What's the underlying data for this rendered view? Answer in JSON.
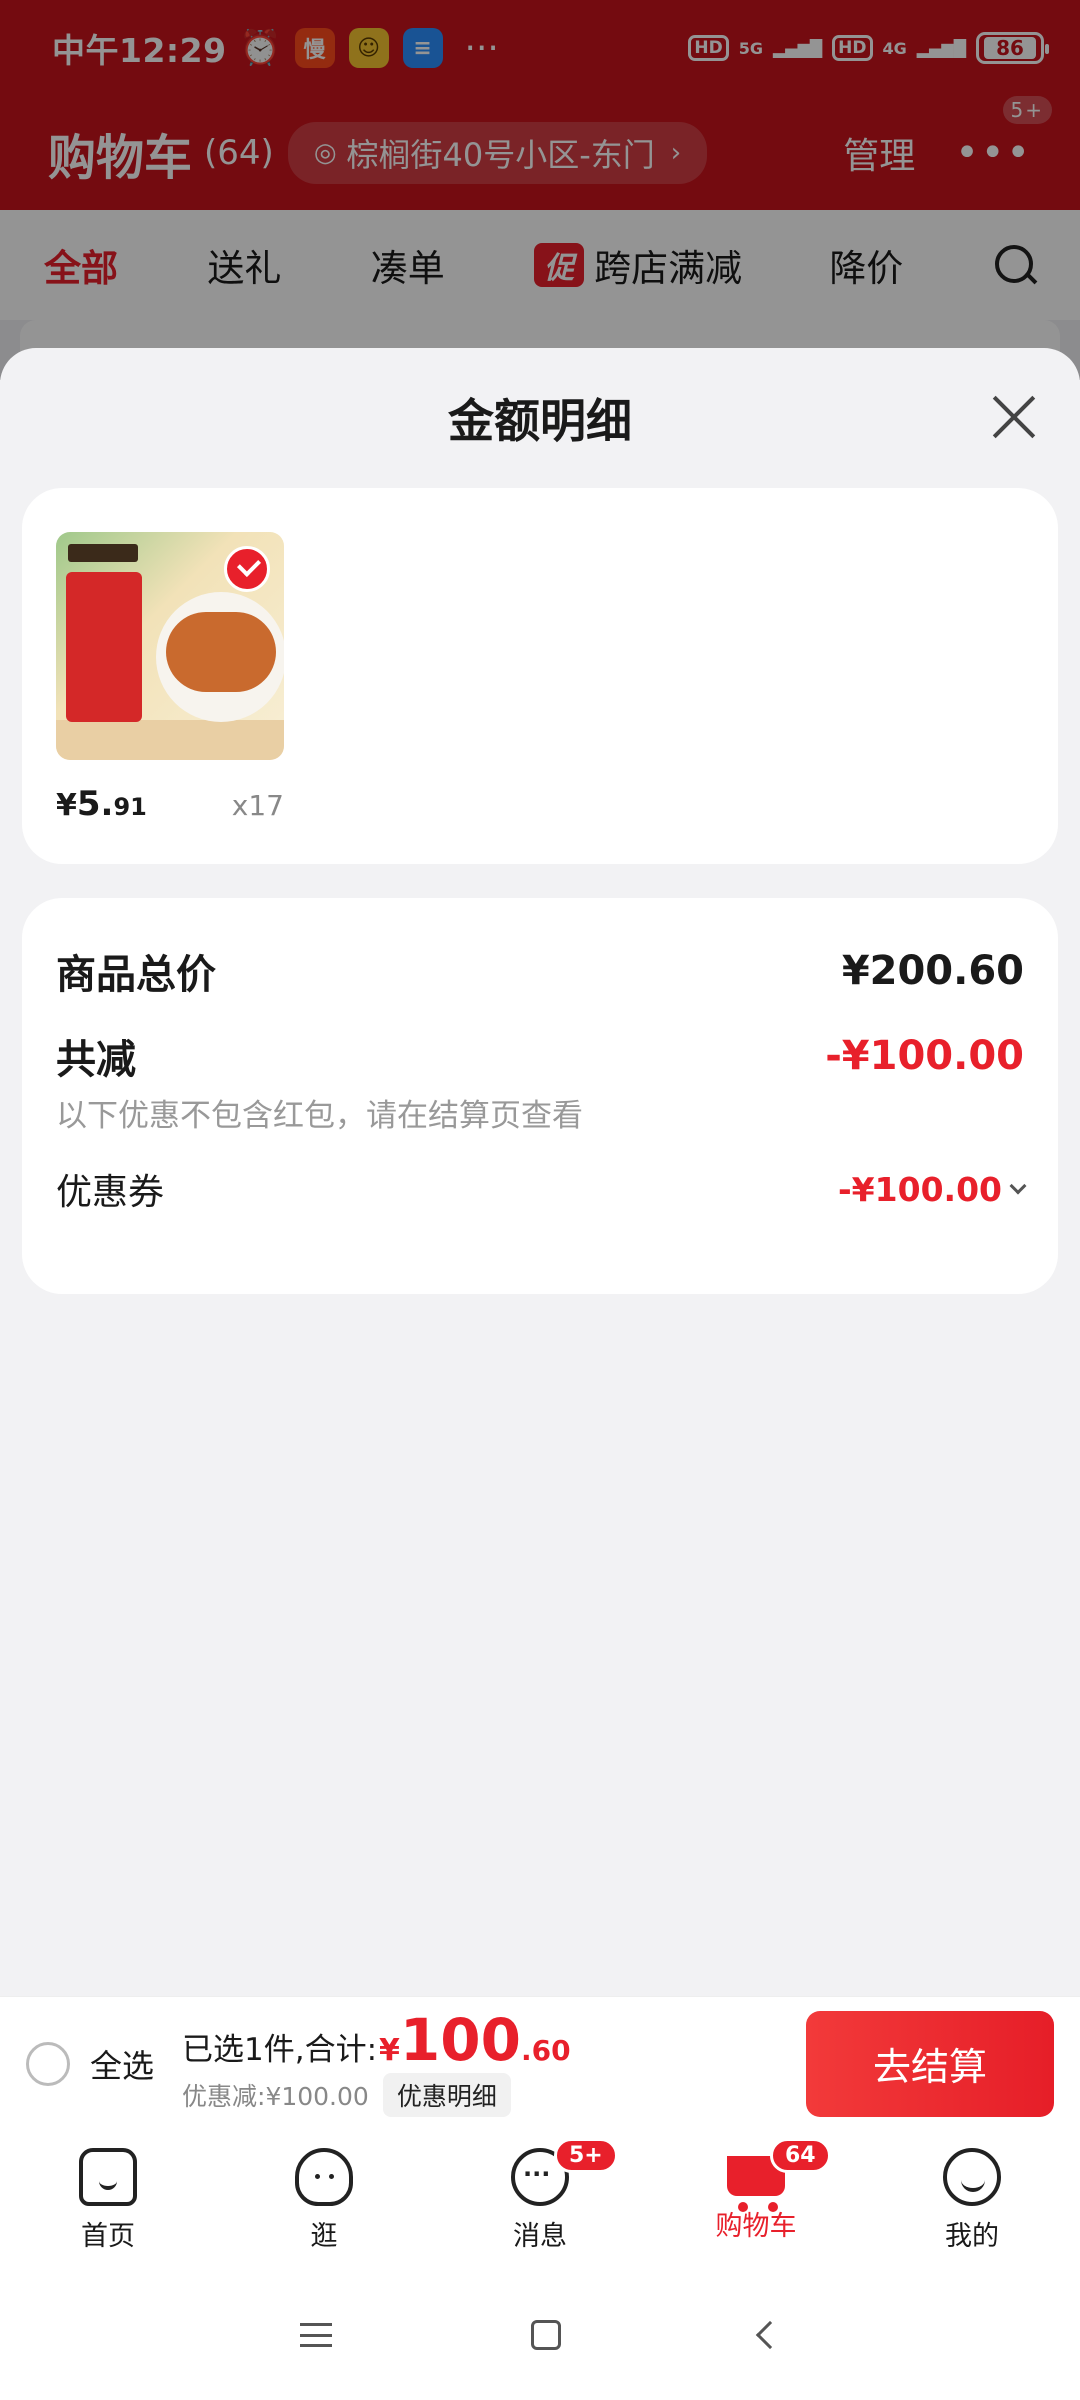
{
  "status_bar": {
    "time": "中午12:29",
    "app_icons": [
      "alarm-icon",
      "app-icon-1",
      "app-icon-2",
      "app-icon-3"
    ],
    "more": "···",
    "network_1": "5G",
    "network_2": "4G",
    "hd": "HD",
    "battery": "86"
  },
  "header": {
    "title": "购物车",
    "count": "(64)",
    "address": "棕榈街40号小区-东门",
    "manage": "管理",
    "more_badge": "5+"
  },
  "filter_tabs": [
    {
      "label": "全部",
      "active": true
    },
    {
      "label": "送礼"
    },
    {
      "label": "凑单"
    },
    {
      "label": "跨店满减",
      "tag": "促"
    },
    {
      "label": "降价"
    }
  ],
  "sheet": {
    "title": "金额明细",
    "product": {
      "price_symbol": "¥",
      "price_int": "5.",
      "price_dec": "91",
      "quantity": "x17"
    },
    "summary": {
      "total_label": "商品总价",
      "total_value": "¥200.60",
      "discount_label": "共减",
      "discount_value": "-¥100.00",
      "note": "以下优惠不包含红包，请在结算页查看",
      "coupon_label": "优惠券",
      "coupon_value": "-¥100.00"
    }
  },
  "checkout": {
    "select_all": "全选",
    "selected_text": "已选1件,合计:",
    "total_symbol": "¥",
    "total_int": "100",
    "total_dec": ".60",
    "discount_text": "优惠减:¥100.00",
    "discount_detail_btn": "优惠明细",
    "submit": "去结算"
  },
  "bottom_nav": [
    {
      "label": "首页",
      "icon": "home-icon"
    },
    {
      "label": "逛",
      "icon": "explore-icon"
    },
    {
      "label": "消息",
      "icon": "message-icon",
      "badge": "5+"
    },
    {
      "label": "购物车",
      "icon": "cart-icon",
      "badge": "64",
      "active": true
    },
    {
      "label": "我的",
      "icon": "profile-icon"
    }
  ],
  "colors": {
    "brand_red": "#e8202b",
    "header_red": "#c8131c",
    "background": "#f2f2f4"
  }
}
